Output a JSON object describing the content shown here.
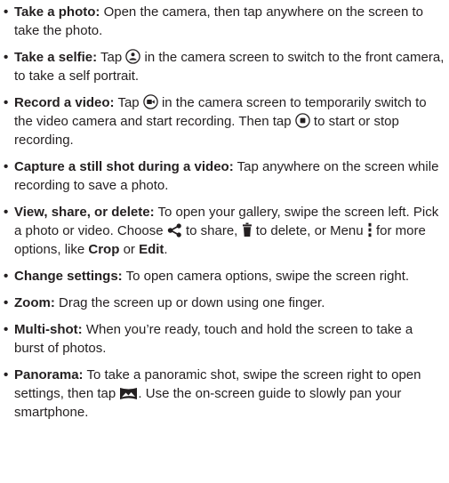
{
  "items": [
    {
      "term": "Take a photo:",
      "text": "Open the camera, then tap anywhere on the screen to take the photo."
    },
    {
      "term": "Take a selfie:",
      "pre": "Tap",
      "post": "in the camera screen to switch to the front camera, to take a self portrait.",
      "icon": "switch-camera-icon"
    },
    {
      "term": "Record a video:",
      "pre": "Tap",
      "mid": "in the camera screen to temporarily switch to the video camera and start recording. Then tap",
      "post": "to start or stop recording.",
      "icons": [
        "video-camera-icon",
        "stop-icon"
      ]
    },
    {
      "term": "Capture a still shot during a video:",
      "text": "Tap anywhere on the screen while recording to save a photo."
    },
    {
      "term": "View, share, or delete:",
      "p1": "To open your gallery, swipe the screen left. Pick a photo or video. Choose",
      "p2": "to share,",
      "p3": "to delete, or Menu",
      "p4": "for more options, like",
      "crop": "Crop",
      "or": "or",
      "edit": "Edit",
      "end": ".",
      "icons": [
        "share-icon",
        "trash-icon",
        "menu-icon"
      ]
    },
    {
      "term": "Change settings:",
      "text": "To open camera options, swipe the screen right."
    },
    {
      "term": "Zoom:",
      "text": "Drag the screen up or down using one finger."
    },
    {
      "term": "Multi-shot:",
      "text": "When you’re ready, touch and hold the screen to take a burst of photos."
    },
    {
      "term": "Panorama:",
      "pre": "To take a panoramic shot, swipe the screen right to open settings, then tap",
      "post": ". Use the on-screen guide to slowly pan your smartphone.",
      "icon": "panorama-icon"
    }
  ],
  "bullet": "•"
}
